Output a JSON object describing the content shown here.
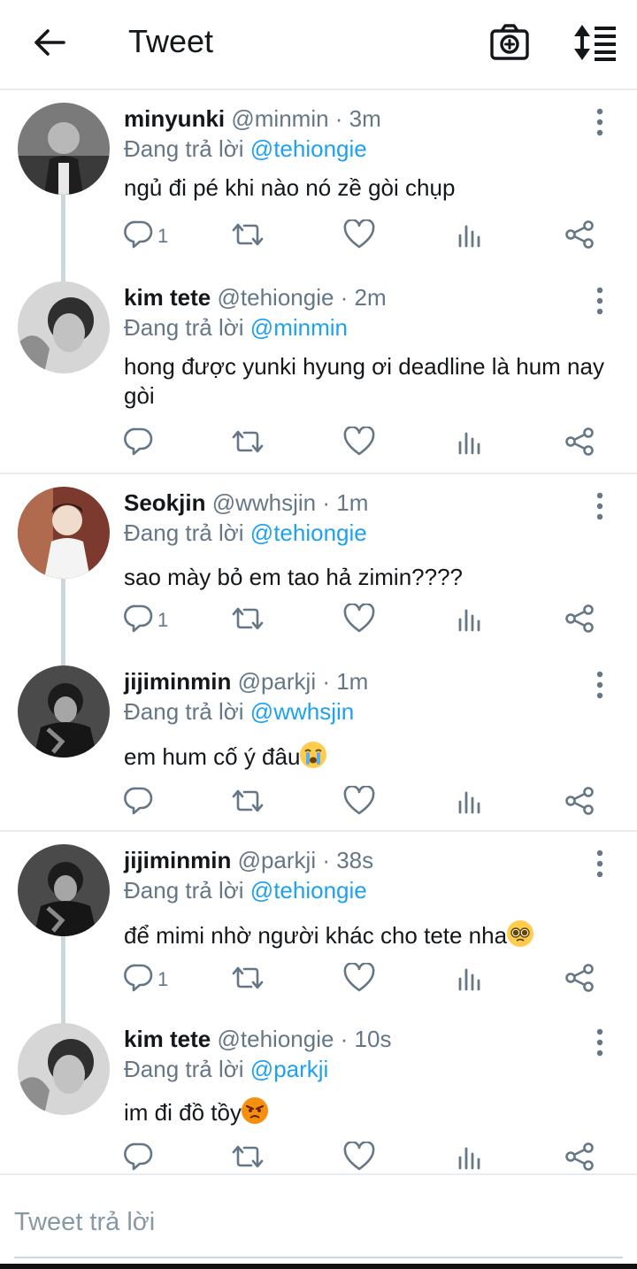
{
  "header": {
    "title": "Tweet"
  },
  "reply_prefix": "Đang trả lời",
  "tweets": [
    {
      "name": "minyunki",
      "handle": "@minmin · 3m",
      "reply_to": "@tehiongie",
      "text": "ngủ đi pé khi nào nó zề gòi chụp",
      "emoji": "",
      "reply_count": "1"
    },
    {
      "name": "kim tete",
      "handle": "@tehiongie · 2m",
      "reply_to": "@minmin",
      "text": "hong được yunki hyung ơi deadline là hum nay gòi",
      "emoji": "",
      "reply_count": ""
    },
    {
      "name": "Seokjin",
      "handle": "@wwhsjin · 1m",
      "reply_to": "@tehiongie",
      "text": "sao mày bỏ em tao hả zimin????",
      "emoji": "",
      "reply_count": "1"
    },
    {
      "name": "jijiminmin",
      "handle": "@parkji · 1m",
      "reply_to": "@wwhsjin",
      "text": "em hum cố ý đâu",
      "emoji": "loudly-crying-face",
      "reply_count": ""
    },
    {
      "name": "jijiminmin",
      "handle": "@parkji · 38s",
      "reply_to": "@tehiongie",
      "text": "để mimi nhờ người khác cho tete nha",
      "emoji": "pleading-face",
      "reply_count": "1"
    },
    {
      "name": "kim tete",
      "handle": "@tehiongie · 10s",
      "reply_to": "@parkji",
      "text": "im đi đồ tồy",
      "emoji": "angry-face",
      "reply_count": ""
    }
  ],
  "composer": {
    "placeholder": "Tweet trả lời"
  },
  "icons": [
    "arrow-left-icon",
    "camera-icon",
    "sort-icon",
    "reply-icon",
    "retweet-icon",
    "like-icon",
    "analytics-icon",
    "share-icon",
    "more-vertical-icon"
  ],
  "colors": {
    "accent": "#1da1f2",
    "text": "#14171a",
    "muted": "#657786",
    "divider": "#e6ecf0"
  }
}
